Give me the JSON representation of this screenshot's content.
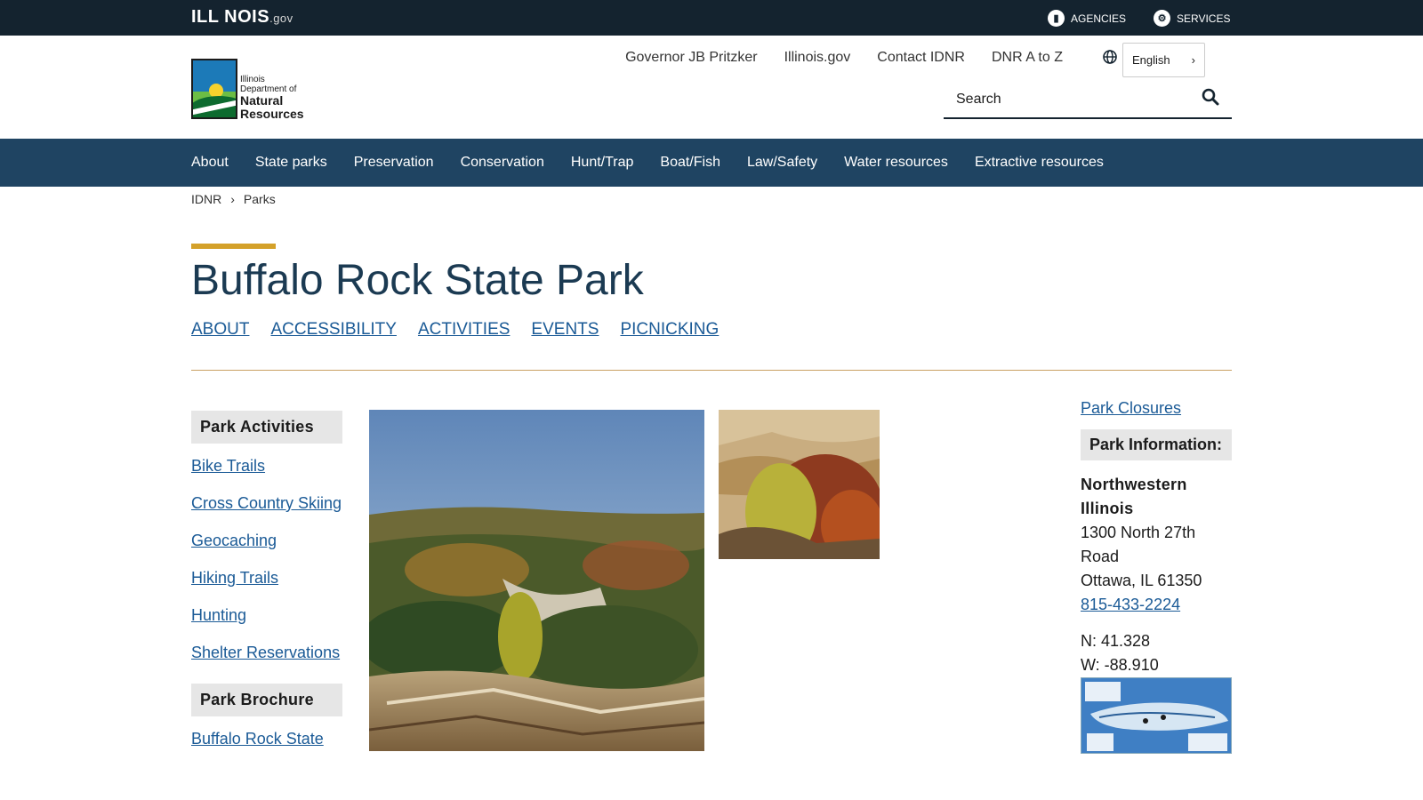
{
  "topbar": {
    "logo_main": "ILL NOIS",
    "logo_suffix": ".gov",
    "agencies_label": "AGENCIES",
    "services_label": "SERVICES"
  },
  "header": {
    "logo_line1": "Illinois",
    "logo_line2": "Department of",
    "logo_line3": "Natural",
    "logo_line4": "Resources",
    "links": [
      "Governor JB Pritzker",
      "Illinois.gov",
      "Contact IDNR",
      "DNR A to Z"
    ],
    "language": "English",
    "search_placeholder": "Search"
  },
  "mainnav": [
    "About",
    "State parks",
    "Preservation",
    "Conservation",
    "Hunt/Trap",
    "Boat/Fish",
    "Law/Safety",
    "Water resources",
    "Extractive resources"
  ],
  "breadcrumb": [
    "IDNR",
    "Parks"
  ],
  "page": {
    "title": "Buffalo Rock State Park",
    "subnav": [
      "ABOUT",
      "ACCESSIBILITY",
      "ACTIVITIES",
      "EVENTS",
      "PICNICKING"
    ]
  },
  "sidebar": {
    "activities_heading": "Park Activities",
    "activities": [
      "Bike Trails",
      "Cross Country Skiing",
      "Geocaching",
      "Hiking Trails",
      "Hunting",
      "Shelter Reservations"
    ],
    "brochure_heading": "Park Brochure",
    "brochure_link": "Buffalo Rock State"
  },
  "info": {
    "closures_link": "Park Closures",
    "heading": "Park Information:",
    "region": "Northwestern Illinois",
    "address1": "1300 North 27th Road",
    "address2": "Ottawa, IL 61350",
    "phone": "815-433-2224",
    "lat": "N: 41.328",
    "lon": "W: -88.910"
  },
  "colors": {
    "topbar": "#14232f",
    "nav": "#1f4462",
    "accent": "#d4a12a",
    "link": "#1a5a96"
  }
}
